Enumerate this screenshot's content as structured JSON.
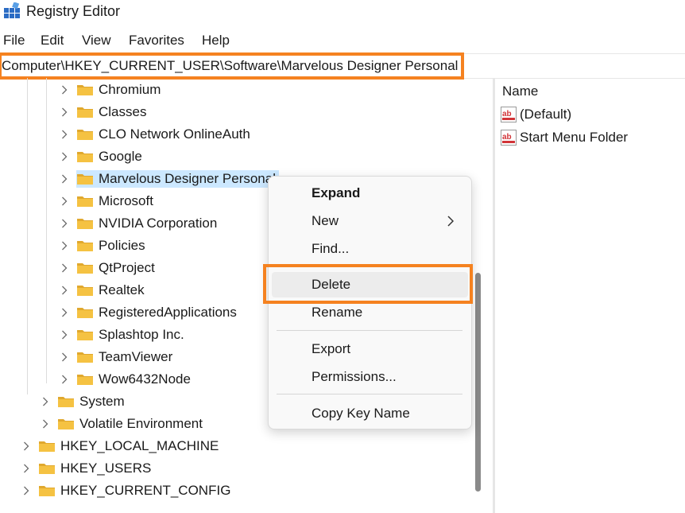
{
  "window": {
    "title": "Registry Editor",
    "icon": "registry-icon"
  },
  "menu": [
    "File",
    "Edit",
    "View",
    "Favorites",
    "Help"
  ],
  "address": {
    "path": "Computer\\HKEY_CURRENT_USER\\Software\\Marvelous Designer Personal"
  },
  "tree": {
    "software_children": [
      "Chromium",
      "Classes",
      "CLO Network OnlineAuth",
      "Google",
      "Marvelous Designer Personal",
      "Microsoft",
      "NVIDIA Corporation",
      "Policies",
      "QtProject",
      "Realtek",
      "RegisteredApplications",
      "Splashtop Inc.",
      "TeamViewer",
      "Wow6432Node"
    ],
    "hkcu_children": [
      "System",
      "Volatile Environment"
    ],
    "roots": [
      "HKEY_LOCAL_MACHINE",
      "HKEY_USERS",
      "HKEY_CURRENT_CONFIG"
    ],
    "selected": "Marvelous Designer Personal"
  },
  "values_pane": {
    "header_name": "Name",
    "rows": [
      {
        "name": "(Default)",
        "icon": "reg-sz-icon"
      },
      {
        "name": "Start Menu Folder",
        "icon": "reg-sz-icon"
      }
    ]
  },
  "context_menu": {
    "expand": "Expand",
    "new": "New",
    "find": "Find...",
    "delete": "Delete",
    "rename": "Rename",
    "export": "Export",
    "permissions": "Permissions...",
    "copy_key_name": "Copy Key Name"
  },
  "colors": {
    "highlight": "#f58220",
    "selection": "#cce8ff",
    "folder": "#f5c242"
  }
}
